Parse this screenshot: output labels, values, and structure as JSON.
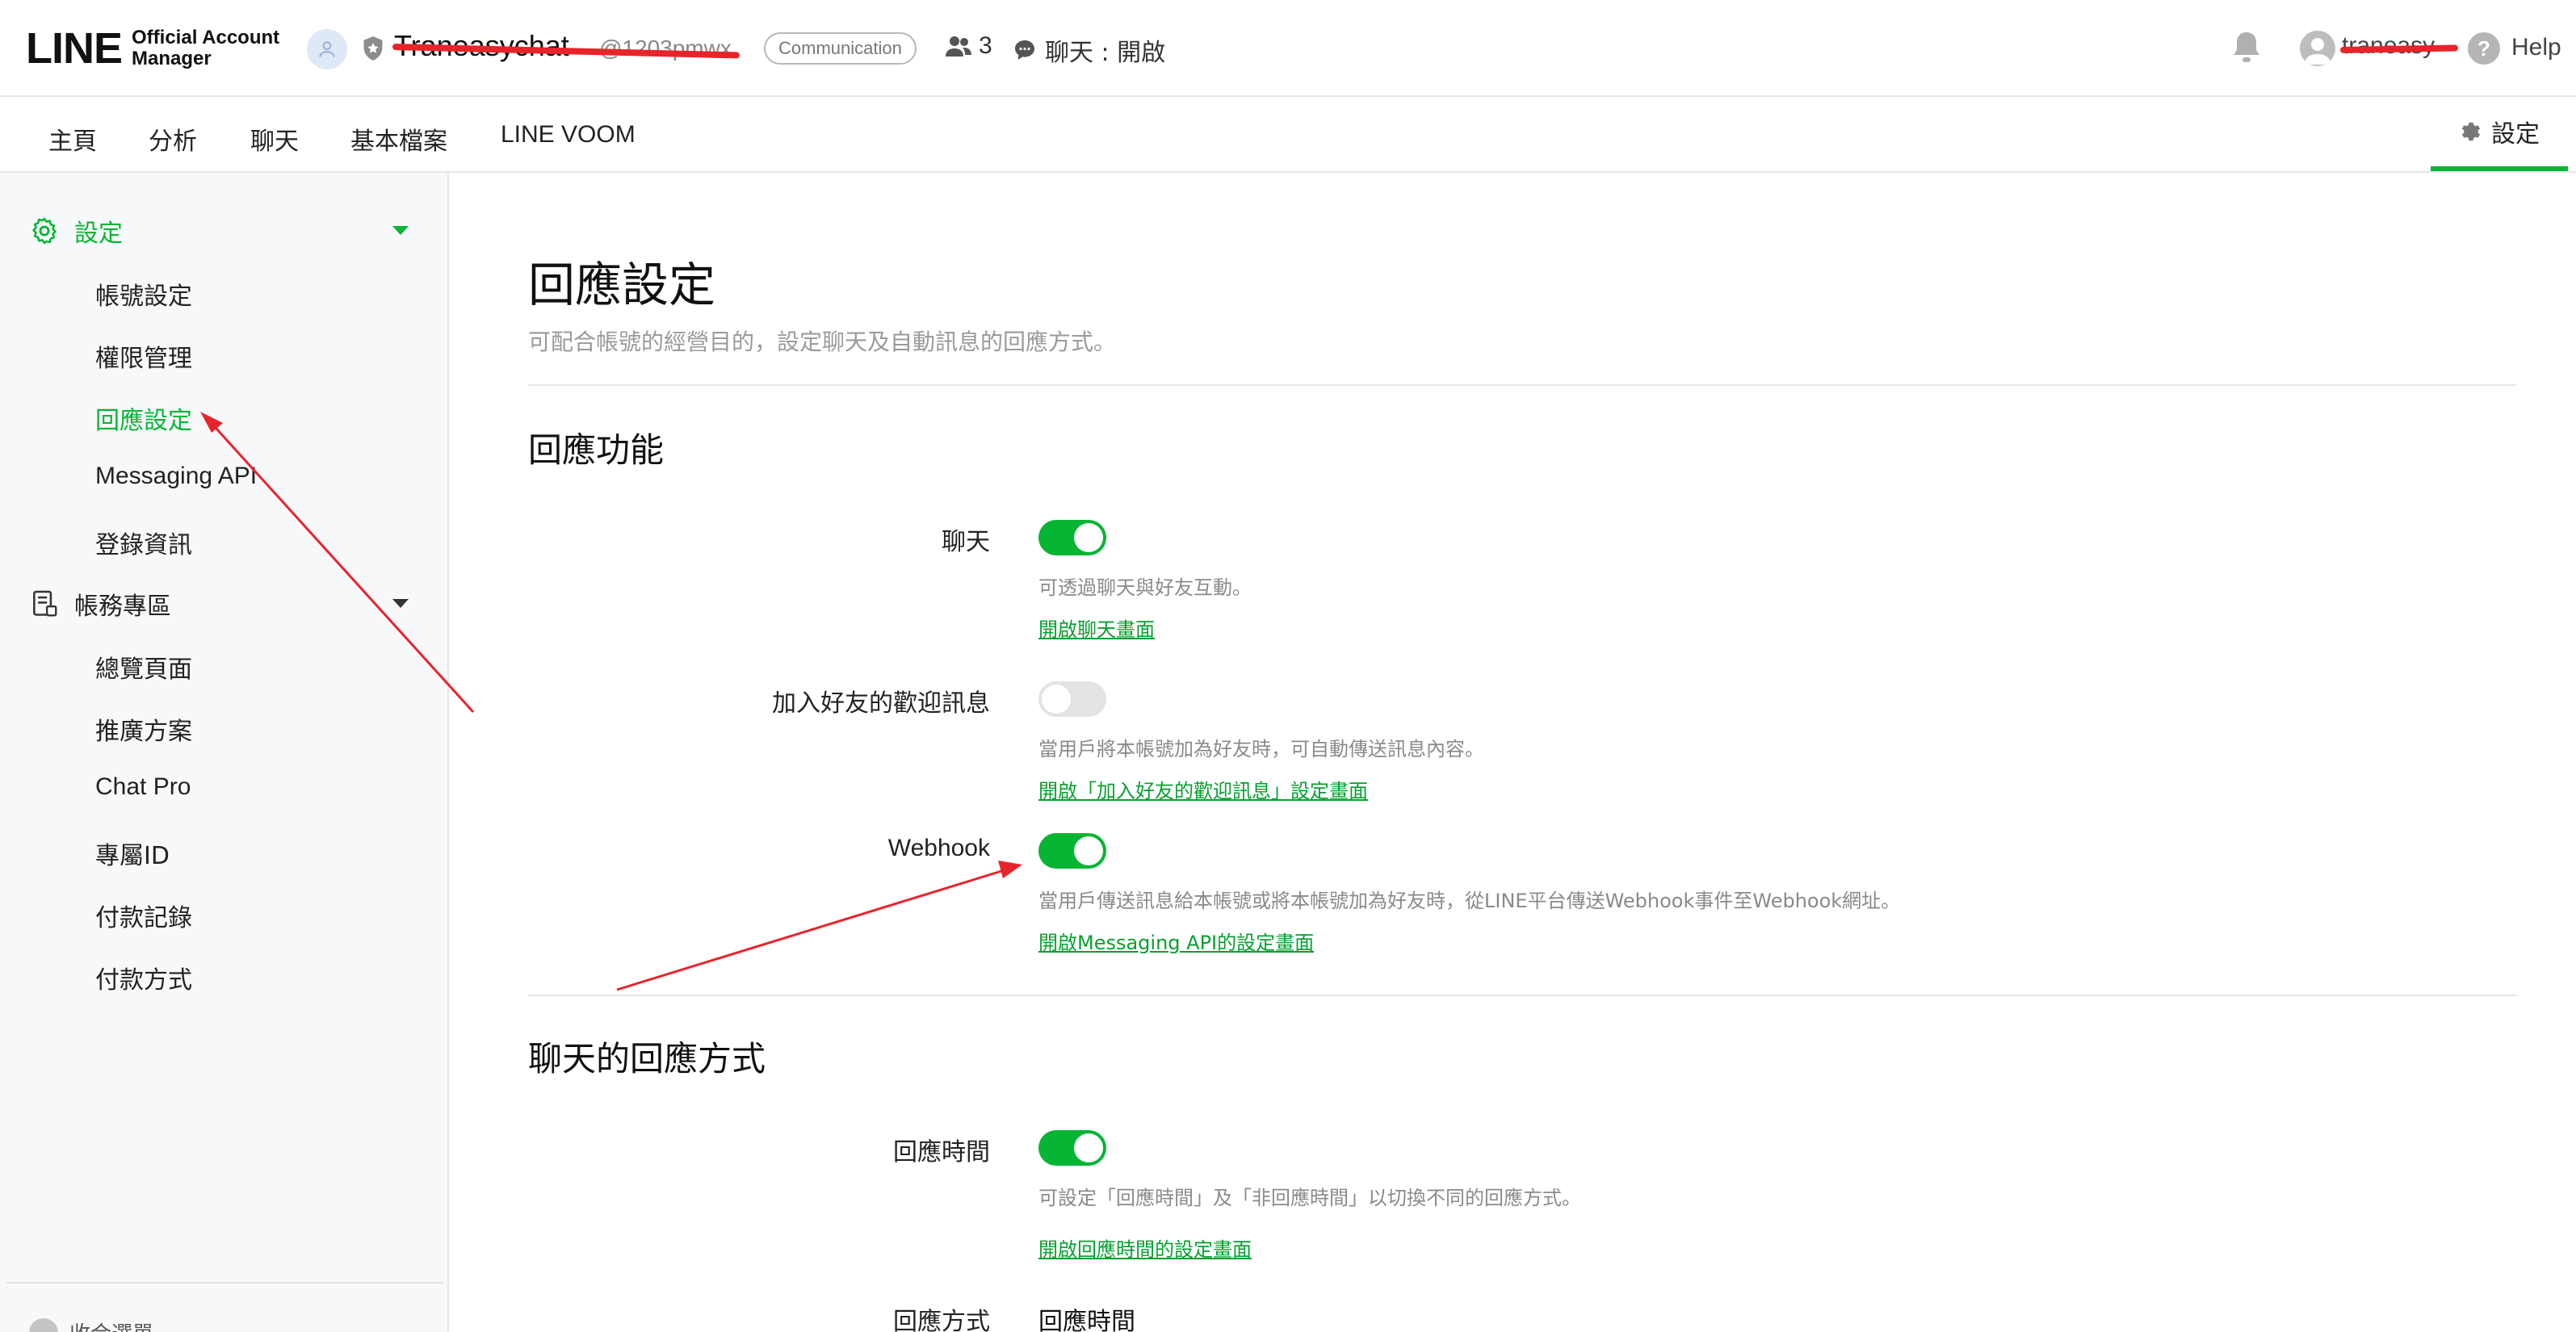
{
  "header": {
    "logo_main": "LINE",
    "logo_sub_line1": "Official Account",
    "logo_sub_line2": "Manager",
    "account_name": "Traneasychat",
    "account_id": "@1203pmwx",
    "category_badge": "Communication",
    "friend_count": "3",
    "chat_status": "聊天 : 開啟",
    "user_name": "traneasy",
    "help_label": "Help"
  },
  "nav": {
    "items": [
      "主頁",
      "分析",
      "聊天",
      "基本檔案",
      "LINE VOOM"
    ],
    "settings": "設定"
  },
  "sidebar": {
    "section_settings": "設定",
    "settings_items": [
      "帳號設定",
      "權限管理",
      "回應設定",
      "Messaging API",
      "登錄資訊"
    ],
    "section_billing": "帳務專區",
    "billing_items": [
      "總覽頁面",
      "推廣方案",
      "Chat Pro",
      "專屬ID",
      "付款記錄",
      "付款方式"
    ],
    "collapse": "收合選單"
  },
  "main": {
    "title": "回應設定",
    "description": "可配合帳號的經營目的，設定聊天及自動訊息的回應方式。",
    "section1_title": "回應功能",
    "chat_label": "聊天",
    "chat_desc": "可透過聊天與好友互動。",
    "chat_link": "開啟聊天畫面",
    "welcome_label": "加入好友的歡迎訊息",
    "welcome_desc": "當用戶將本帳號加為好友時，可自動傳送訊息內容。",
    "welcome_link": "開啟「加入好友的歡迎訊息」設定畫面",
    "webhook_label": "Webhook",
    "webhook_desc": "當用戶傳送訊息給本帳號或將本帳號加為好友時，從LINE平台傳送Webhook事件至Webhook網址。",
    "webhook_link": "開啟Messaging API的設定畫面",
    "section2_title": "聊天的回應方式",
    "hours_label": "回應時間",
    "hours_desc": "可設定「回應時間」及「非回應時間」以切換不同的回應方式。",
    "hours_link": "開啟回應時間的設定畫面",
    "method_label": "回應方式",
    "method_value": "回應時間"
  },
  "toggles": {
    "chat": true,
    "welcome": false,
    "webhook": true,
    "hours": true
  },
  "colors": {
    "accent_green": "#06b534",
    "annotation_red": "#e8242b"
  }
}
